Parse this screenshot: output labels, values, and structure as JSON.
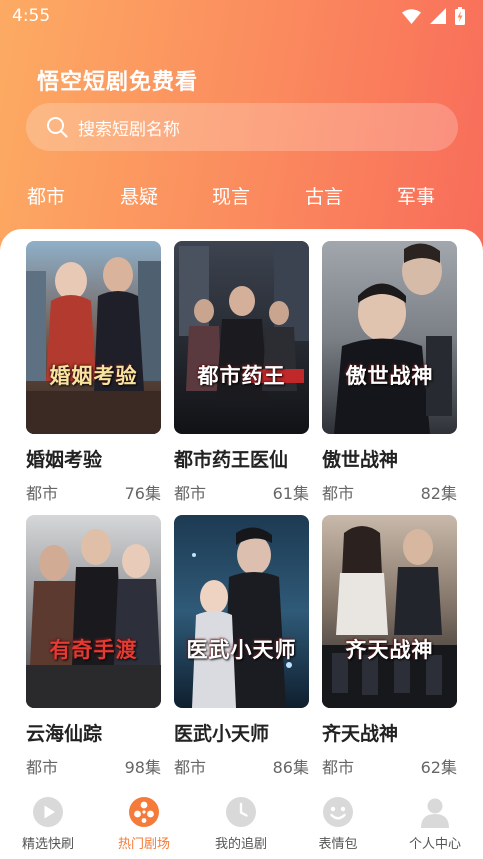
{
  "status_bar": {
    "time": "4:55"
  },
  "header": {
    "app_title": "悟空短剧免费看",
    "search_placeholder": "搜索短剧名称"
  },
  "categories": [
    "都市",
    "悬疑",
    "现言",
    "古言",
    "军事"
  ],
  "dramas": [
    {
      "title": "婚姻考验",
      "genre": "都市",
      "episodes": "76集",
      "poster_text": "婚姻考验"
    },
    {
      "title": "都市药王医仙",
      "genre": "都市",
      "episodes": "61集",
      "poster_text": "都市药王"
    },
    {
      "title": "傲世战神",
      "genre": "都市",
      "episodes": "82集",
      "poster_text": "傲世战神"
    },
    {
      "title": "云海仙踪",
      "genre": "都市",
      "episodes": "98集",
      "poster_text": "有奇手渡"
    },
    {
      "title": "医武小天师",
      "genre": "都市",
      "episodes": "86集",
      "poster_text": "医武小天师"
    },
    {
      "title": "齐天战神",
      "genre": "都市",
      "episodes": "62集",
      "poster_text": "齐天战神"
    }
  ],
  "bottom_nav": [
    {
      "label": "精选快刷",
      "icon": "play-icon",
      "active": false
    },
    {
      "label": "热门剧场",
      "icon": "film-reel-icon",
      "active": true
    },
    {
      "label": "我的追剧",
      "icon": "clock-icon",
      "active": false
    },
    {
      "label": "表情包",
      "icon": "smiley-icon",
      "active": false
    },
    {
      "label": "个人中心",
      "icon": "person-icon",
      "active": false
    }
  ],
  "colors": {
    "header_gradient_start": "#fcab63",
    "header_gradient_end": "#f86c5a",
    "accent": "#f47b3a",
    "inactive_icon": "#d9d9d9"
  }
}
